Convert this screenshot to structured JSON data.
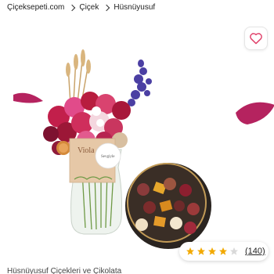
{
  "breadcrumb": {
    "items": [
      "Çiçeksepeti.com",
      "Çiçek",
      "Hüsnüyusuf"
    ]
  },
  "favorite": {
    "icon": "heart-outline-icon"
  },
  "rating": {
    "stars": 4,
    "max_stars": 5,
    "count_label": "(140)",
    "star_color": "#f2a900",
    "empty_star_color": "#d9d9d9"
  },
  "product": {
    "title": "Hüsnüyusuf Çiçekleri ve Çikolata",
    "vase_tag_text": "Viola",
    "card_text": "Sevgiyle"
  }
}
